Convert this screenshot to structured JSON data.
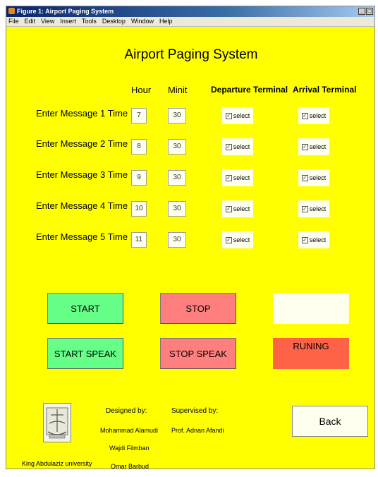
{
  "window": {
    "title": "Figure 1: Airport Paging System",
    "menu": [
      "File",
      "Edit",
      "View",
      "Insert",
      "Tools",
      "Desktop",
      "Window",
      "Help"
    ]
  },
  "app": {
    "title": "Airport Paging System",
    "columns": {
      "hour": "Hour",
      "minute": "Minit",
      "departure": "Departure Terminal",
      "arrival": "Arrival Terminal"
    },
    "rows": [
      {
        "label": "Enter Message 1 Time :",
        "hour": "7",
        "minute": "30",
        "dep": "select",
        "arr": "select"
      },
      {
        "label": "Enter Message 2 Time :",
        "hour": "8",
        "minute": "30",
        "dep": "select",
        "arr": "select"
      },
      {
        "label": "Enter Message 3 Time :",
        "hour": "9",
        "minute": "30",
        "dep": "select",
        "arr": "select"
      },
      {
        "label": "Enter Message 4 Time :",
        "hour": "10",
        "minute": "30",
        "dep": "select",
        "arr": "select"
      },
      {
        "label": "Enter Message 5 Time :",
        "hour": "11",
        "minute": "30",
        "dep": "select",
        "arr": "select"
      }
    ],
    "buttons": {
      "start": "START",
      "stop": "STOP",
      "start_speak": "START SPEAK",
      "stop_speak": "STOP SPEAK",
      "back": "Back"
    },
    "status": {
      "text": "RUNING",
      "display": ""
    },
    "credits": {
      "designed_label": "Designed by:",
      "designers": [
        "Mohammad Alamudi",
        "Wajdi Filmban",
        "Omar Barbud"
      ],
      "supervised_label": "Supervised by:",
      "supervisor": "Prof. Adnan Afandi",
      "university": "King Abdulaziz university"
    },
    "colors": {
      "background": "#ffff00",
      "green_button": "#66ff88",
      "red_button": "#ff7f7f",
      "status": "#ff6347"
    }
  }
}
